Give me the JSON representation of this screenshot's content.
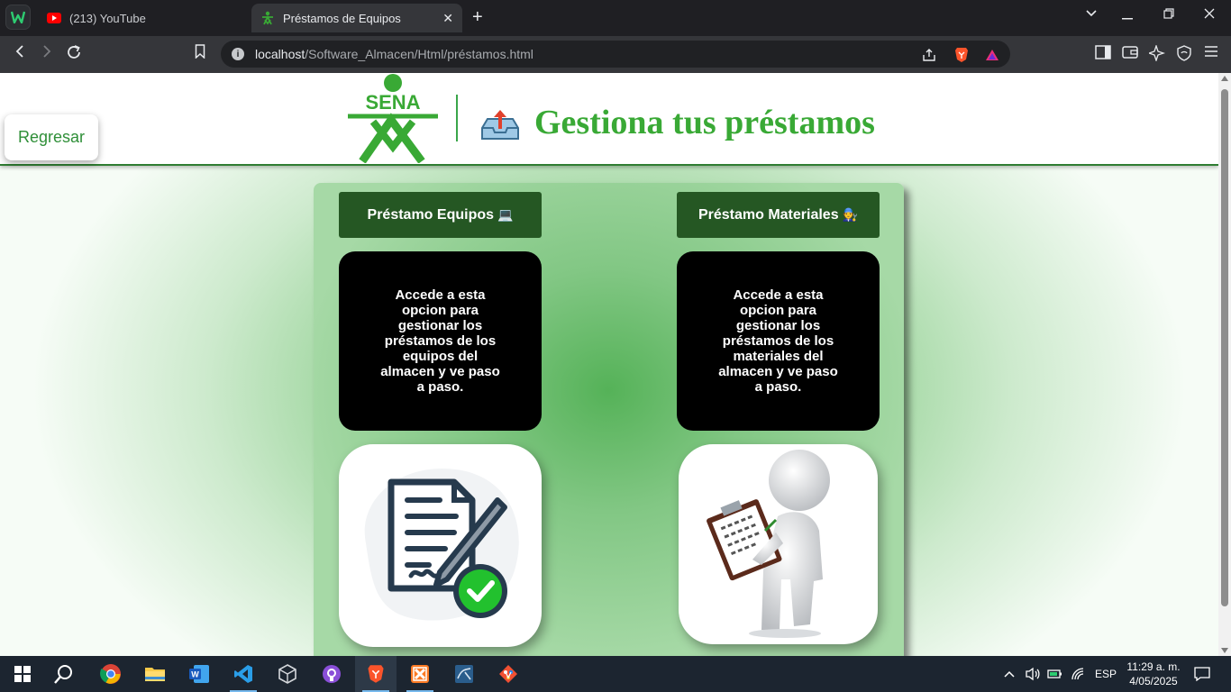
{
  "browser": {
    "tabs": [
      {
        "title": "(213) YouTube",
        "active": false
      },
      {
        "title": "Préstamos de Equipos",
        "active": true
      }
    ],
    "new_tab": "+",
    "url_host": "localhost",
    "url_path": "/Software_Almacen/Html/préstamos.html",
    "window_controls": {
      "dropdown": "⌄",
      "minimize": "—",
      "restore": "❐",
      "close": "✕"
    }
  },
  "header": {
    "back_button": "Regresar",
    "logo_text": "SENA",
    "title": "Gestiona tus préstamos"
  },
  "cards": [
    {
      "title": "Préstamo Equipos",
      "title_emoji": "💻",
      "description": "Accede a esta opcion para gestionar los préstamos de los equipos del almacen y ve paso a paso."
    },
    {
      "title": "Préstamo Materiales",
      "title_emoji": "🧑‍🔧",
      "description": "Accede a esta opcion para gestionar los préstamos de los materiales del almacen y ve paso a paso."
    }
  ],
  "taskbar": {
    "apps": [
      "start-icon",
      "search-icon",
      "chrome-icon",
      "file-explorer-icon",
      "word-icon",
      "vscode-icon",
      "unity-icon",
      "github-desktop-icon",
      "brave-icon",
      "xampp-icon",
      "mysql-workbench-icon",
      "git-icon"
    ],
    "language": "ESP",
    "time": "11:29 a. m.",
    "date": "4/05/2025"
  },
  "colors": {
    "brand_green": "#39a935",
    "card_title_bg": "#255723",
    "card_desc_bg": "#000000",
    "header_border": "#2f7d32"
  }
}
